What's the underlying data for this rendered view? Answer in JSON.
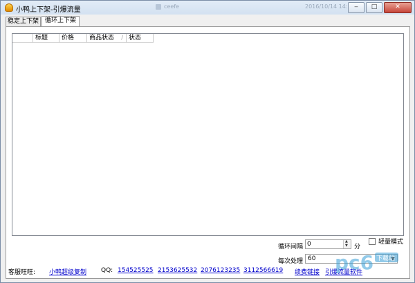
{
  "window": {
    "title": "小鸭上下架-引爆流量",
    "background_ghost_title": "ceefe",
    "background_ghost_date": "2016/10/14 14:19 …",
    "controls": {
      "minimize": "‒",
      "maximize": "□",
      "close": "✕"
    }
  },
  "tabs": [
    {
      "label": "稳定上下架",
      "active": false
    },
    {
      "label": "循环上下架",
      "active": true
    }
  ],
  "listview": {
    "columns": [
      "",
      "标题",
      "价格",
      "商品状态",
      "状态"
    ],
    "sort_indicator": "/",
    "rows": []
  },
  "controls": {
    "interval_label": "循环间隔",
    "interval_value": "0",
    "interval_unit": "分",
    "light_mode_label": "轻量模式",
    "light_mode_checked": false,
    "per_process_label": "每次处理",
    "per_process_value": "60"
  },
  "footer": {
    "support_label": "客服旺旺:",
    "support_link": "小鸭超级复制",
    "qq_label": "QQ:",
    "qq_numbers": [
      "154525525",
      "2153625532",
      "2076123235",
      "3112566619"
    ],
    "link_1": "续费链接",
    "link_2": "引爆流量软件"
  },
  "watermark": {
    "text": "pc6",
    "subtext": "下载站"
  },
  "colors": {
    "titlebar": "#dbe6f3",
    "link": "#0000cc",
    "close_button": "#c7463a",
    "watermark": "#3aa0d8"
  }
}
